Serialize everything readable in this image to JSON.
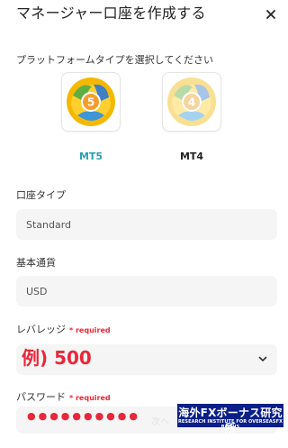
{
  "header": {
    "title": "マネージャー口座を作成する",
    "close_icon": "close-icon"
  },
  "platform_section": {
    "label": "プラットフォームタイプを選択してください",
    "options": [
      {
        "name": "MT5",
        "version_digit": "5",
        "selected": true,
        "color": "#2a9fb2"
      },
      {
        "name": "MT4",
        "version_digit": "4",
        "selected": false,
        "color": "#222222"
      }
    ]
  },
  "account_type": {
    "label": "口座タイプ",
    "value": "Standard"
  },
  "base_currency": {
    "label": "基本通貨",
    "value": "USD"
  },
  "leverage": {
    "label": "レバレッジ",
    "required": "* required",
    "example": "例) 500",
    "chevron_icon": "chevron-down-icon"
  },
  "password": {
    "label": "パスワード",
    "required": "* required",
    "masked_value": "●●●●●●●●●●",
    "next_label": "次へ"
  },
  "watermark": {
    "main": "海外FXボーナス研究所",
    "sub": "RESEARCH INSTITUTE FOR OVERSEASFX BONUS"
  },
  "colors": {
    "accent": "#2a9fb2",
    "required_red": "#e8283a",
    "field_bg": "#f5f5f5",
    "watermark_bg": "#0a1f88"
  }
}
